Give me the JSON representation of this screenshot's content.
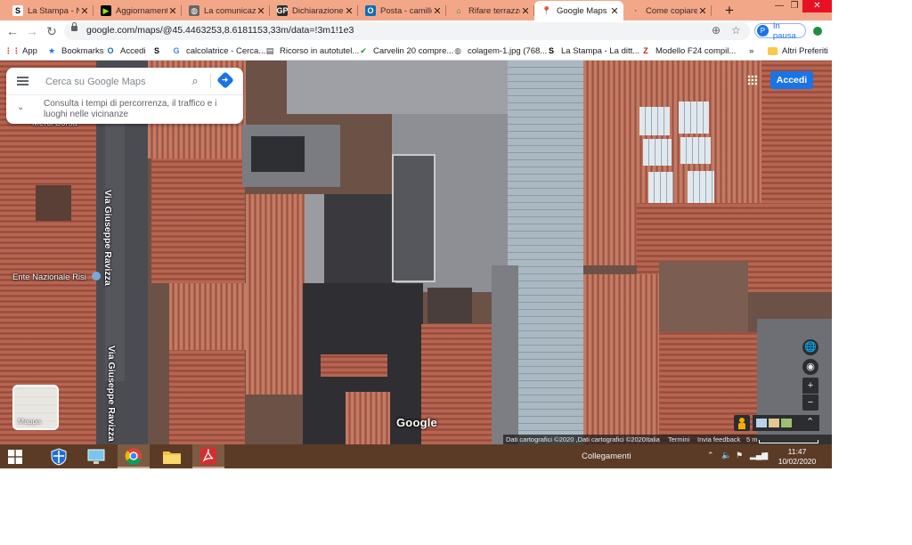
{
  "browser": {
    "tabs": [
      {
        "label": "La Stampa - N",
        "favicon": "S",
        "fav_bg": "#ffffff",
        "fav_fg": "#000000",
        "active": false
      },
      {
        "label": "Aggiornamenti",
        "favicon": "▶",
        "fav_bg": "#000000",
        "fav_fg": "#7cfc00",
        "active": false
      },
      {
        "label": "La comunicazio",
        "favicon": "◍",
        "fav_bg": "#666666",
        "fav_fg": "#ffffff",
        "active": false
      },
      {
        "label": "Dichiarazione R",
        "favicon": "GP",
        "fav_bg": "#2c2c2c",
        "fav_fg": "#ffffff",
        "active": false
      },
      {
        "label": "Posta - camillo",
        "favicon": "O",
        "fav_bg": "#0f6cbd",
        "fav_fg": "#ffffff",
        "active": false
      },
      {
        "label": "Rifare terrazzo",
        "favicon": "⌂",
        "fav_bg": "#f3a789",
        "fav_fg": "#1e8e3e",
        "active": false
      },
      {
        "label": "Google Maps",
        "favicon": "📍",
        "fav_bg": "#ffffff",
        "fav_fg": "#ea4335",
        "active": true
      },
      {
        "label": "Come copiare u",
        "favicon": "·",
        "fav_bg": "#f3a789",
        "fav_fg": "#555555",
        "active": false
      }
    ],
    "new_tab": "+",
    "window_controls": {
      "minimize": "—",
      "restore": "❐",
      "close": "✕"
    },
    "url": "google.com/maps/@45.4463253,8.6181153,33m/data=!3m1!1e3",
    "profile": {
      "initial": "P",
      "label": "In pausa"
    },
    "bookmarks": [
      {
        "label": "App",
        "icon": "⋮⋮",
        "color": "#ea4335"
      },
      {
        "label": "Bookmarks",
        "icon": "★",
        "color": "#1a73e8"
      },
      {
        "label": "Accedi",
        "icon": "O",
        "color": "#0f6cbd"
      },
      {
        "label": "",
        "icon": "S",
        "color": "#000000"
      },
      {
        "label": "calcolatrice - Cerca...",
        "icon": "G",
        "color": "#4285f4"
      },
      {
        "label": "Ricorso in autotutel...",
        "icon": "▤",
        "color": "#333333"
      },
      {
        "label": "Carvelin 20 compre...",
        "icon": "✔",
        "color": "#1e8e3e"
      },
      {
        "label": "colagem-1.jpg (768...",
        "icon": "◍",
        "color": "#555555"
      },
      {
        "label": "La Stampa - La ditt...",
        "icon": "S",
        "color": "#000000"
      },
      {
        "label": "Modello F24 compil...",
        "icon": "Z",
        "color": "#c5221f"
      }
    ],
    "bookmarks_more": "»",
    "other_bookmarks": "Altri Preferiti"
  },
  "maps": {
    "search_placeholder": "Cerca su Google Maps",
    "hint": "Consulta i tempi di percorrenza, il traffico e i luoghi nelle vicinanze",
    "accedi": "Accedi",
    "street_labels": [
      "Via Giuseppe Ravizza",
      "Via Giuseppe Ravizza"
    ],
    "poi": "Ente Nazionale Risi",
    "partial_label": "Merci Borsa",
    "layer_label": "Mappa",
    "logo": "Google",
    "attribution": {
      "data": "Dati cartografici ©2020 ,Dati cartografici ©2020",
      "country": "Italia",
      "terms": "Termini",
      "feedback": "Invia feedback",
      "scale": "5 m"
    },
    "controls": {
      "globe": "🌐",
      "locate": "◉",
      "zoom_in": "+",
      "zoom_out": "−",
      "expand": "⌃"
    }
  },
  "taskbar": {
    "links_label": "Collegamenti",
    "time": "11:47",
    "date": "10/02/2020"
  }
}
